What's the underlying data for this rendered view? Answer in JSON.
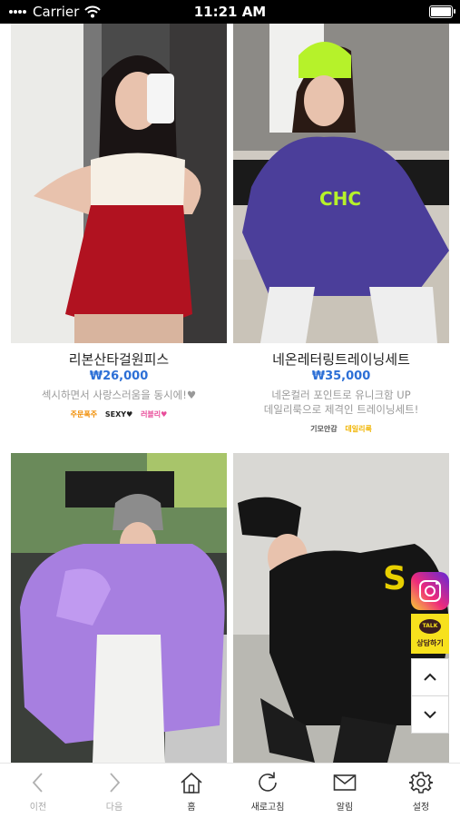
{
  "status_bar": {
    "carrier": "Carrier",
    "time": "11:21 AM"
  },
  "products": [
    {
      "title": "리본산타걸원피스",
      "price": "₩26,000",
      "description_lines": [
        "섹시하면서 사랑스러움을 동시에!♥"
      ],
      "tags": [
        {
          "text": "주문폭주",
          "color": "#f08c00"
        },
        {
          "text": "SEXY♥",
          "color": "#e0214a"
        },
        {
          "text": "러블리♥",
          "color": "#e84d9a"
        }
      ]
    },
    {
      "title": "네온레터링트레이닝세트",
      "price": "₩35,000",
      "description_lines": [
        "네온컬러 포인트로 유니크함 UP",
        "데일리룩으로 제격인 트레이닝세트!"
      ],
      "tags": [
        {
          "text": "기모안감",
          "color": "#555555"
        },
        {
          "text": "데일리룩",
          "color": "#f0b400"
        }
      ]
    },
    {
      "title": "",
      "price": "",
      "description_lines": [],
      "tags": []
    },
    {
      "title": "",
      "price": "",
      "description_lines": [],
      "tags": []
    }
  ],
  "floating": {
    "kakao_badge": "TALK",
    "kakao_label": "상담하기"
  },
  "tabbar": [
    {
      "label": "이전",
      "icon": "chevron-left-icon",
      "enabled": false
    },
    {
      "label": "다음",
      "icon": "chevron-right-icon",
      "enabled": false
    },
    {
      "label": "홈",
      "icon": "home-icon",
      "enabled": true
    },
    {
      "label": "새로고침",
      "icon": "refresh-icon",
      "enabled": true
    },
    {
      "label": "알림",
      "icon": "mail-icon",
      "enabled": true
    },
    {
      "label": "설정",
      "icon": "gear-icon",
      "enabled": true
    }
  ],
  "colors": {
    "price": "#2c6fd6",
    "text_disabled": "#a8a8a8",
    "text_enabled": "#333333"
  }
}
